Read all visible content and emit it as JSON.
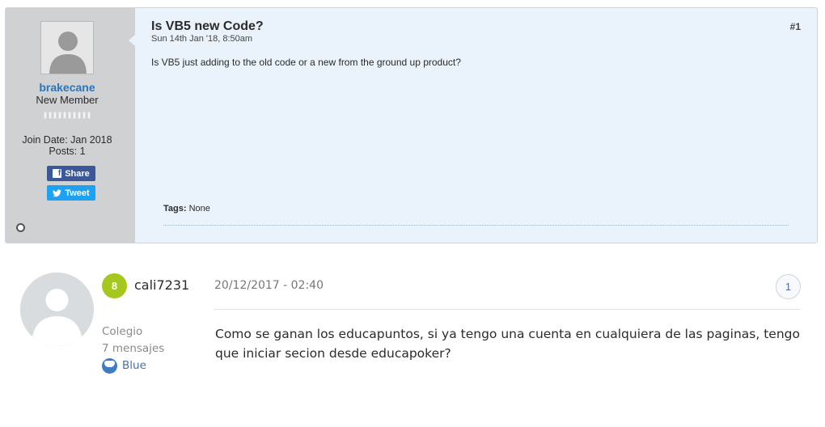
{
  "post1": {
    "username": "brakecane",
    "rank": "New Member",
    "join_date": "Join Date: Jan 2018",
    "posts": "Posts: 1",
    "share_label": "Share",
    "tweet_label": "Tweet",
    "title": "Is VB5 new Code?",
    "date": "Sun 14th Jan '18, 8:50am",
    "number": "#1",
    "body": "Is VB5 just adding to the old code or a new from the ground up product?",
    "tags_label": "Tags:",
    "tags_value": "None",
    "share_icon": "facebook-icon",
    "tweet_icon": "twitter-icon"
  },
  "post2": {
    "level": "8",
    "username": "cali7231",
    "date": "20/12/2017 - 02:40",
    "number": "1",
    "role": "Colegio",
    "messages": "7 mensajes",
    "team": "Blue",
    "body": "Como se ganan los educapuntos, si ya tengo una cuenta en cualquiera de las paginas, tengo que iniciar secion desde educapoker?"
  },
  "colors": {
    "post1_bg": "#eaf2fb",
    "sidebar_bg": "#cfd1d3",
    "username_blue": "#2a76b8",
    "facebook": "#3b5998",
    "twitter": "#1da1f2",
    "level_badge": "#a6c81e"
  }
}
